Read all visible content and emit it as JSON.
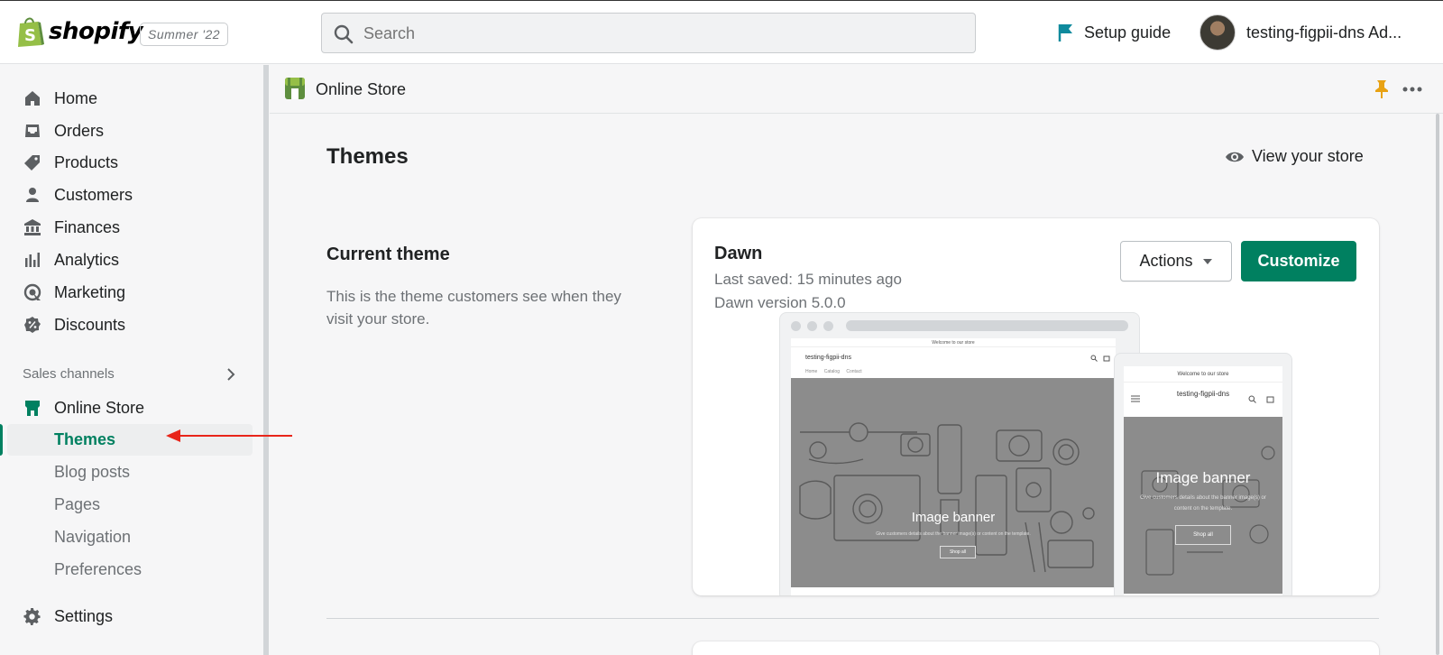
{
  "topbar": {
    "brand": "shopify",
    "edition": "Summer '22",
    "search_placeholder": "Search",
    "setup_guide": "Setup guide",
    "account_name": "testing-figpii-dns Ad..."
  },
  "sidebar": {
    "items": [
      {
        "label": "Home",
        "icon": "home-icon"
      },
      {
        "label": "Orders",
        "icon": "orders-icon"
      },
      {
        "label": "Products",
        "icon": "tag-icon"
      },
      {
        "label": "Customers",
        "icon": "person-icon"
      },
      {
        "label": "Finances",
        "icon": "bank-icon"
      },
      {
        "label": "Analytics",
        "icon": "bar-chart-icon"
      },
      {
        "label": "Marketing",
        "icon": "target-icon"
      },
      {
        "label": "Discounts",
        "icon": "discount-icon"
      }
    ],
    "sales_channels_label": "Sales channels",
    "online_store": "Online Store",
    "sub_items": [
      "Themes",
      "Blog posts",
      "Pages",
      "Navigation",
      "Preferences"
    ],
    "active_sub_item": "Themes",
    "settings": "Settings"
  },
  "mainbar": {
    "title": "Online Store"
  },
  "page": {
    "title": "Themes",
    "view_store": "View your store",
    "current_theme_heading": "Current theme",
    "current_theme_desc": "This is the theme customers see when they visit your store."
  },
  "theme_card": {
    "name": "Dawn",
    "last_saved": "Last saved: 15 minutes ago",
    "version": "Dawn version 5.0.0",
    "actions_label": "Actions",
    "customize_label": "Customize"
  },
  "preview": {
    "desktop_announcement": "Welcome to our store",
    "desktop_store_name": "testing-figpii-dns",
    "desktop_nav": [
      "Home",
      "Catalog",
      "Contact"
    ],
    "desktop_banner_title": "Image banner",
    "desktop_banner_sub": "Give customers details about the banner image(s) or content on the template.",
    "desktop_banner_button": "Shop all",
    "mobile_announcement": "Welcome to our store",
    "mobile_store_name": "testing-figpii-dns",
    "mobile_banner_title": "Image banner",
    "mobile_banner_sub": "Give customers details about the banner image(s) or content on the template.",
    "mobile_banner_button": "Shop all"
  },
  "colors": {
    "primary": "#008060",
    "annotation_arrow": "#e8251a",
    "pin": "#e8a214"
  }
}
